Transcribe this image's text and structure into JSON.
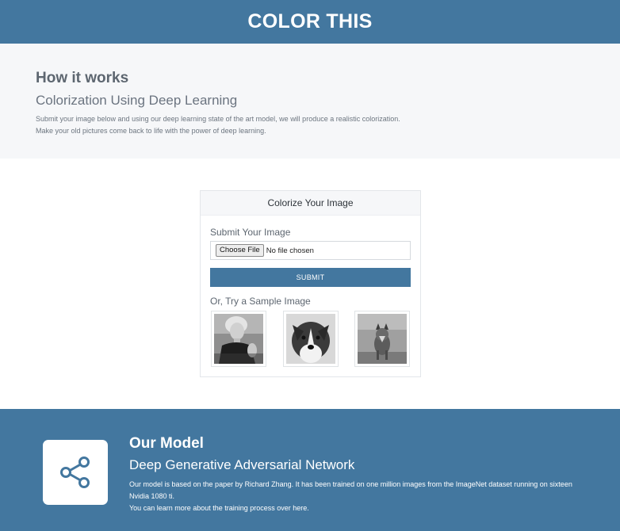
{
  "header": {
    "title": "COLOR THIS"
  },
  "how": {
    "title": "How it works",
    "subtitle": "Colorization Using Deep Learning",
    "line1": "Submit your image below and using our deep learning state of the art model, we will produce a realistic colorization.",
    "line2": "Make your old pictures come back to life with the power of deep learning."
  },
  "card": {
    "title": "Colorize Your Image",
    "submit_label": "Submit Your Image",
    "choose_file": "Choose File",
    "no_file": "No file chosen",
    "submit_button": "SUBMIT",
    "sample_label": "Or, Try a Sample Image",
    "samples": [
      "woman-portrait",
      "dog",
      "wolf"
    ]
  },
  "footer": {
    "icon": "share-icon",
    "title": "Our Model",
    "subtitle": "Deep Generative Adversarial Network",
    "line1": "Our model is based on the paper by Richard Zhang. It has been trained on one million images from the ImageNet dataset running on sixteen Nvidia 1080 ti.",
    "line2": "You can learn more about the training process over here."
  },
  "colors": {
    "brand": "#43779f",
    "light_bg": "#f6f7f9"
  }
}
